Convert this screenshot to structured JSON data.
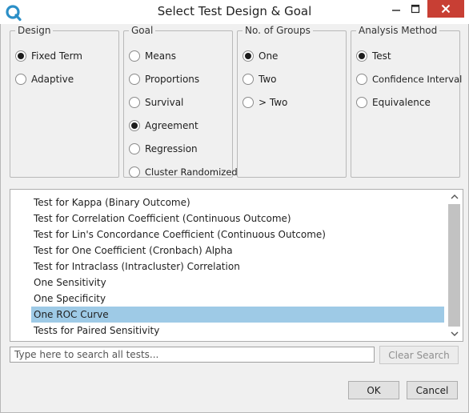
{
  "window": {
    "title": "Select Test Design & Goal",
    "icons": {
      "logo": "app-logo-icon",
      "minimize": "minimize-icon",
      "maximize": "maximize-icon",
      "close": "close-icon"
    },
    "colors": {
      "close_button": "#c83f34",
      "selection": "#9ecae6",
      "logo": "#2b8fc7"
    }
  },
  "groups": {
    "design": {
      "legend": "Design",
      "options": [
        {
          "label": "Fixed Term",
          "selected": true
        },
        {
          "label": "Adaptive",
          "selected": false
        }
      ]
    },
    "goal": {
      "legend": "Goal",
      "options": [
        {
          "label": "Means",
          "selected": false
        },
        {
          "label": "Proportions",
          "selected": false
        },
        {
          "label": "Survival",
          "selected": false
        },
        {
          "label": "Agreement",
          "selected": true
        },
        {
          "label": "Regression",
          "selected": false
        },
        {
          "label": "Cluster Randomized",
          "selected": false
        }
      ]
    },
    "groups_count": {
      "legend": "No. of Groups",
      "options": [
        {
          "label": "One",
          "selected": true
        },
        {
          "label": "Two",
          "selected": false
        },
        {
          "label": "> Two",
          "selected": false
        }
      ]
    },
    "analysis": {
      "legend": "Analysis Method",
      "options": [
        {
          "label": "Test",
          "selected": true
        },
        {
          "label": "Confidence Interval",
          "selected": false
        },
        {
          "label": "Equivalence",
          "selected": false
        }
      ]
    }
  },
  "tests": {
    "items": [
      "Test for Kappa (Binary Outcome)",
      "Test for Correlation Coefficient (Continuous Outcome)",
      "Test for Lin's Concordance Coefficient (Continuous Outcome)",
      "Test for One Coefficient (Cronbach) Alpha",
      "Test for Intraclass (Intracluster) Correlation",
      "One Sensitivity",
      "One Specificity",
      "One ROC Curve",
      "Tests for Paired Sensitivity"
    ],
    "selected_index": 7,
    "scroll_icons": {
      "up": "chevron-up-icon",
      "down": "chevron-down-icon"
    }
  },
  "search": {
    "placeholder": "Type here to search all tests...",
    "value": "",
    "clear_label": "Clear Search"
  },
  "footer": {
    "ok_label": "OK",
    "cancel_label": "Cancel"
  }
}
